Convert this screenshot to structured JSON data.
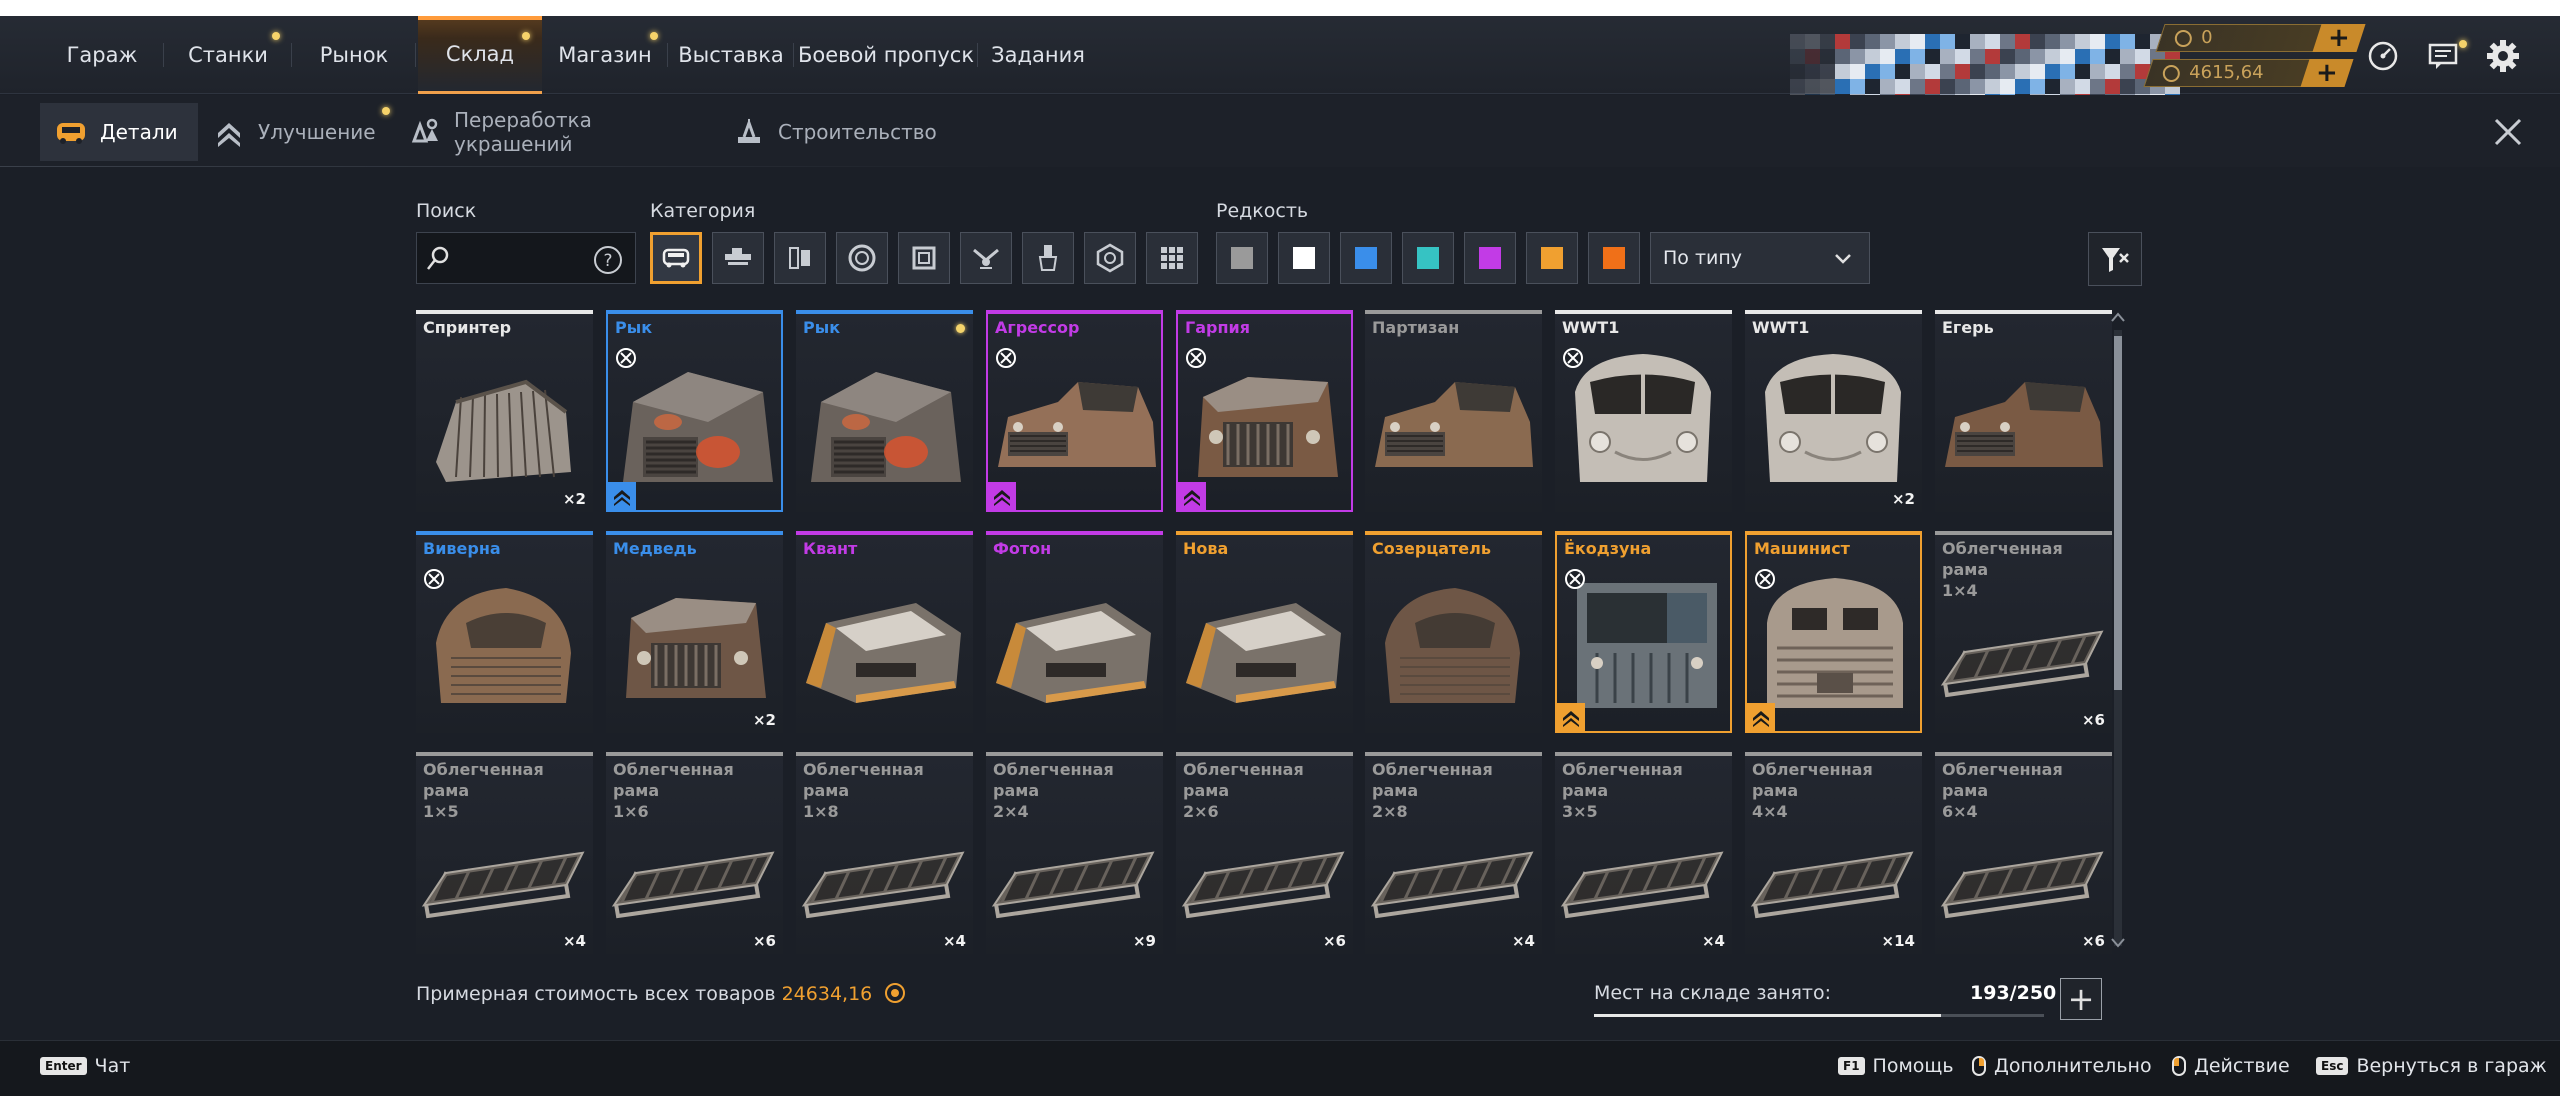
{
  "nav": {
    "tabs": [
      "Гараж",
      "Станки",
      "Рынок",
      "Склад",
      "Магазин",
      "Выставка",
      "Боевой пропуск",
      "Задания"
    ],
    "active": "Склад"
  },
  "currency": {
    "coins": "0",
    "crystals": "4615,64"
  },
  "subnav": {
    "tabs": [
      "Детали",
      "Улучшение",
      "Переработка украшений",
      "Строительство"
    ],
    "active": "Детали"
  },
  "filters": {
    "search_label": "Поиск",
    "search_value": "",
    "category_label": "Категория",
    "category_icons": [
      "cabin-icon",
      "weapon-icon",
      "module-icon",
      "wheel-icon",
      "frame-icon",
      "drone-icon",
      "paint-icon",
      "hardware-icon",
      "grid-icon"
    ],
    "rarity_label": "Редкость",
    "rarity_colors": [
      "#9a9a9a",
      "#ffffff",
      "#3a8eea",
      "#36c3c3",
      "#c23be6",
      "#f0a030",
      "#f07018"
    ],
    "sort_value": "По типу"
  },
  "items": [
    {
      "name": "Спринтер",
      "rarity": "#e8e8e8",
      "qty": "×2",
      "craft": false,
      "upgrade": false,
      "dot": false,
      "boxed": false,
      "art": "cage"
    },
    {
      "name": "Рык",
      "rarity": "#3a8eea",
      "qty": "",
      "craft": true,
      "upgrade": true,
      "dot": false,
      "boxed": true,
      "art": "armored"
    },
    {
      "name": "Рык",
      "rarity": "#3a8eea",
      "qty": "",
      "craft": false,
      "upgrade": false,
      "dot": true,
      "boxed": false,
      "art": "armored"
    },
    {
      "name": "Агрессор",
      "rarity": "#c23be6",
      "qty": "",
      "craft": true,
      "upgrade": true,
      "dot": false,
      "boxed": true,
      "art": "pickup"
    },
    {
      "name": "Гарпия",
      "rarity": "#c23be6",
      "qty": "",
      "craft": true,
      "upgrade": true,
      "dot": false,
      "boxed": true,
      "art": "truckfront"
    },
    {
      "name": "Партизан",
      "rarity": "#9a9a9a",
      "qty": "",
      "craft": false,
      "upgrade": false,
      "dot": false,
      "boxed": false,
      "art": "pickup"
    },
    {
      "name": "WWT1",
      "rarity": "#e8e8e8",
      "qty": "",
      "craft": true,
      "upgrade": false,
      "dot": false,
      "boxed": false,
      "art": "van"
    },
    {
      "name": "WWT1",
      "rarity": "#e8e8e8",
      "qty": "×2",
      "craft": false,
      "upgrade": false,
      "dot": false,
      "boxed": false,
      "art": "van"
    },
    {
      "name": "Егерь",
      "rarity": "#e8e8e8",
      "qty": "",
      "craft": false,
      "upgrade": false,
      "dot": false,
      "boxed": false,
      "art": "pickup"
    },
    {
      "name": "Виверна",
      "rarity": "#3a8eea",
      "qty": "",
      "craft": true,
      "upgrade": false,
      "dot": false,
      "boxed": false,
      "art": "round"
    },
    {
      "name": "Медведь",
      "rarity": "#3a8eea",
      "qty": "×2",
      "craft": false,
      "upgrade": false,
      "dot": false,
      "boxed": false,
      "art": "truckfront"
    },
    {
      "name": "Квант",
      "rarity": "#c23be6",
      "qty": "",
      "craft": false,
      "upgrade": false,
      "dot": false,
      "boxed": false,
      "art": "sleek"
    },
    {
      "name": "Фотон",
      "rarity": "#c23be6",
      "qty": "",
      "craft": false,
      "upgrade": false,
      "dot": false,
      "boxed": false,
      "art": "sleek"
    },
    {
      "name": "Нова",
      "rarity": "#f0a030",
      "qty": "",
      "craft": false,
      "upgrade": false,
      "dot": false,
      "boxed": false,
      "art": "sleek"
    },
    {
      "name": "Созерцатель",
      "rarity": "#f0a030",
      "qty": "",
      "craft": false,
      "upgrade": false,
      "dot": false,
      "boxed": false,
      "art": "round"
    },
    {
      "name": "Ёкодзуна",
      "rarity": "#f0a030",
      "qty": "",
      "craft": true,
      "upgrade": true,
      "dot": false,
      "boxed": true,
      "art": "boxcab"
    },
    {
      "name": "Машинист",
      "rarity": "#f0a030",
      "qty": "",
      "craft": true,
      "upgrade": true,
      "dot": false,
      "boxed": true,
      "art": "train"
    },
    {
      "name": "Облегченная рама\n1×4",
      "rarity": "#9a9a9a",
      "qty": "×6",
      "craft": false,
      "upgrade": false,
      "dot": false,
      "boxed": false,
      "art": "frame"
    },
    {
      "name": "Облегченная рама\n1×5",
      "rarity": "#9a9a9a",
      "qty": "×4",
      "craft": false,
      "upgrade": false,
      "dot": false,
      "boxed": false,
      "art": "frame"
    },
    {
      "name": "Облегченная рама\n1×6",
      "rarity": "#9a9a9a",
      "qty": "×6",
      "craft": false,
      "upgrade": false,
      "dot": false,
      "boxed": false,
      "art": "frame"
    },
    {
      "name": "Облегченная рама\n1×8",
      "rarity": "#9a9a9a",
      "qty": "×4",
      "craft": false,
      "upgrade": false,
      "dot": false,
      "boxed": false,
      "art": "frame"
    },
    {
      "name": "Облегченная рама\n2×4",
      "rarity": "#9a9a9a",
      "qty": "×9",
      "craft": false,
      "upgrade": false,
      "dot": false,
      "boxed": false,
      "art": "frame"
    },
    {
      "name": "Облегченная рама\n2×6",
      "rarity": "#9a9a9a",
      "qty": "×6",
      "craft": false,
      "upgrade": false,
      "dot": false,
      "boxed": false,
      "art": "frame"
    },
    {
      "name": "Облегченная рама\n2×8",
      "rarity": "#9a9a9a",
      "qty": "×4",
      "craft": false,
      "upgrade": false,
      "dot": false,
      "boxed": false,
      "art": "frame"
    },
    {
      "name": "Облегченная рама\n3×5",
      "rarity": "#9a9a9a",
      "qty": "×4",
      "craft": false,
      "upgrade": false,
      "dot": false,
      "boxed": false,
      "art": "frame"
    },
    {
      "name": "Облегченная рама\n4×4",
      "rarity": "#9a9a9a",
      "qty": "×14",
      "craft": false,
      "upgrade": false,
      "dot": false,
      "boxed": false,
      "art": "frame"
    },
    {
      "name": "Облегченная рама\n6×4",
      "rarity": "#9a9a9a",
      "qty": "×6",
      "craft": false,
      "upgrade": false,
      "dot": false,
      "boxed": false,
      "art": "frame"
    }
  ],
  "bottom": {
    "total_label": "Примерная стоимость всех товаров",
    "total_value": "24634,16",
    "storage_label": "Мест на складе занято:",
    "storage_count": "193/250",
    "storage_fraction": 0.772
  },
  "footer": {
    "chat_key": "Enter",
    "chat": "Чат",
    "help_key": "F1",
    "help": "Помощь",
    "extra": "Дополнительно",
    "action": "Действие",
    "back_key": "Esc",
    "back": "Вернуться в гараж"
  }
}
